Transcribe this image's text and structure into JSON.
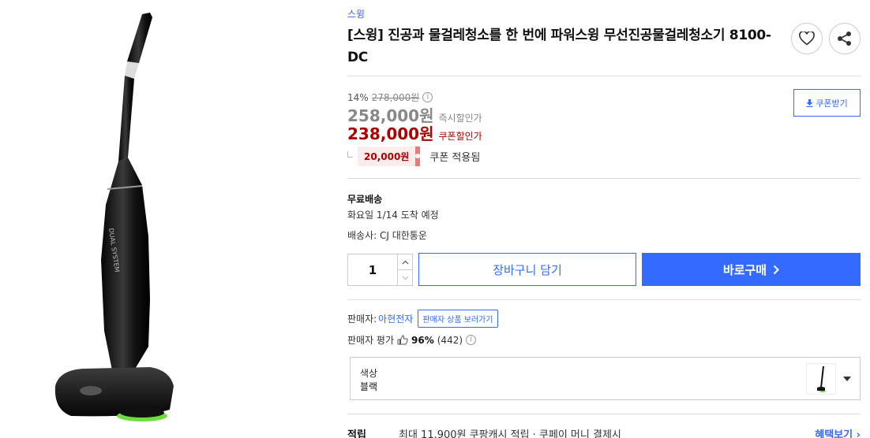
{
  "product": {
    "brand": "스윙",
    "title": "[스윙] 진공과 물걸레청소를 한 번에 파워스윙 무선진공물걸레청소기 8100-DC",
    "image_alt": "블랙 무선 진공 물걸레 청소기",
    "image_text": "DUAL SYSTEM"
  },
  "price": {
    "discount_rate": "14%",
    "original_price": "278,000원",
    "instant_price": "258,000원",
    "instant_label": "즉시할인가",
    "coupon_price": "238,000원",
    "coupon_label": "쿠폰할인가",
    "coupon_amount": "20,000원",
    "coupon_applied_label": "쿠폰 적용됨",
    "coupon_download_label": "쿠폰받기"
  },
  "shipping": {
    "type": "무료배송",
    "arrival": "화요일 1/14 도착 예정",
    "carrier": "배송사: CJ 대한통운"
  },
  "purchase": {
    "quantity": "1",
    "cart_label": "장바구니 담기",
    "buy_label": "바로구매"
  },
  "seller": {
    "prefix": "판매자:",
    "name": "아현전자",
    "view_products_label": "판매자 상품 보러가기",
    "rating_label": "판매자 평가",
    "rating_percent": "96%",
    "rating_count": "(442)"
  },
  "option": {
    "label": "색상",
    "value": "블랙"
  },
  "reward": {
    "label": "적립",
    "text": "최대 11,900원 쿠팡캐시 적립 · 쿠페이 머니 결제시",
    "benefit_link": "혜택보기"
  },
  "icons": {
    "wishlist": "heart-icon",
    "share": "share-icon",
    "download": "download-icon",
    "info": "info-icon",
    "thumbs_up": "thumbs-up-icon",
    "chevron": "chevron-right-icon",
    "dropdown": "caret-down-icon"
  },
  "colors": {
    "accent": "#346aff",
    "coupon_red": "#ae0000"
  }
}
